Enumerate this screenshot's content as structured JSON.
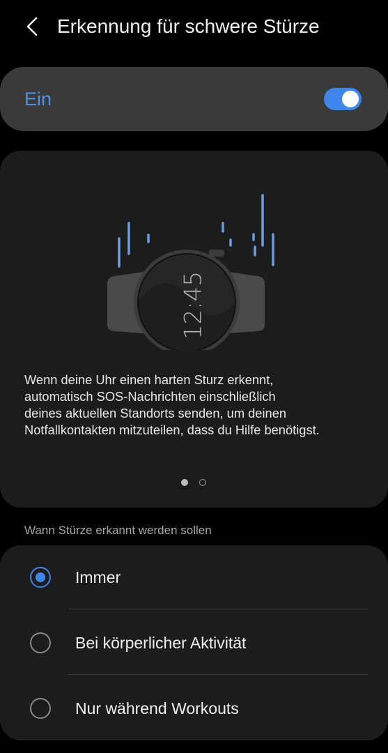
{
  "header": {
    "title": "Erkennung für schwere Stürze",
    "back_icon": "chevron-left-icon"
  },
  "toggle": {
    "label": "Ein",
    "state": true,
    "accent_color": "#3e86ea"
  },
  "illustration": {
    "watch_time": "12:45",
    "accent_color": "#6f9be0"
  },
  "description": {
    "lines": [
      "Wenn deine Uhr einen harten Sturz erkennt,",
      "automatisch SOS-Nachrichten einschließlich",
      "deines aktuellen Standorts senden, um deinen",
      "Notfallkontakten mitzuteilen, dass du Hilfe benötigst."
    ]
  },
  "pager": {
    "current_page": 1,
    "page_count": 2
  },
  "detection": {
    "section_label": "Wann Stürze erkannt werden sollen",
    "options": [
      {
        "label": "Immer",
        "selected": true
      },
      {
        "label": "Bei körperlicher Aktivität",
        "selected": false
      },
      {
        "label": "Nur während Workouts",
        "selected": false
      }
    ]
  }
}
